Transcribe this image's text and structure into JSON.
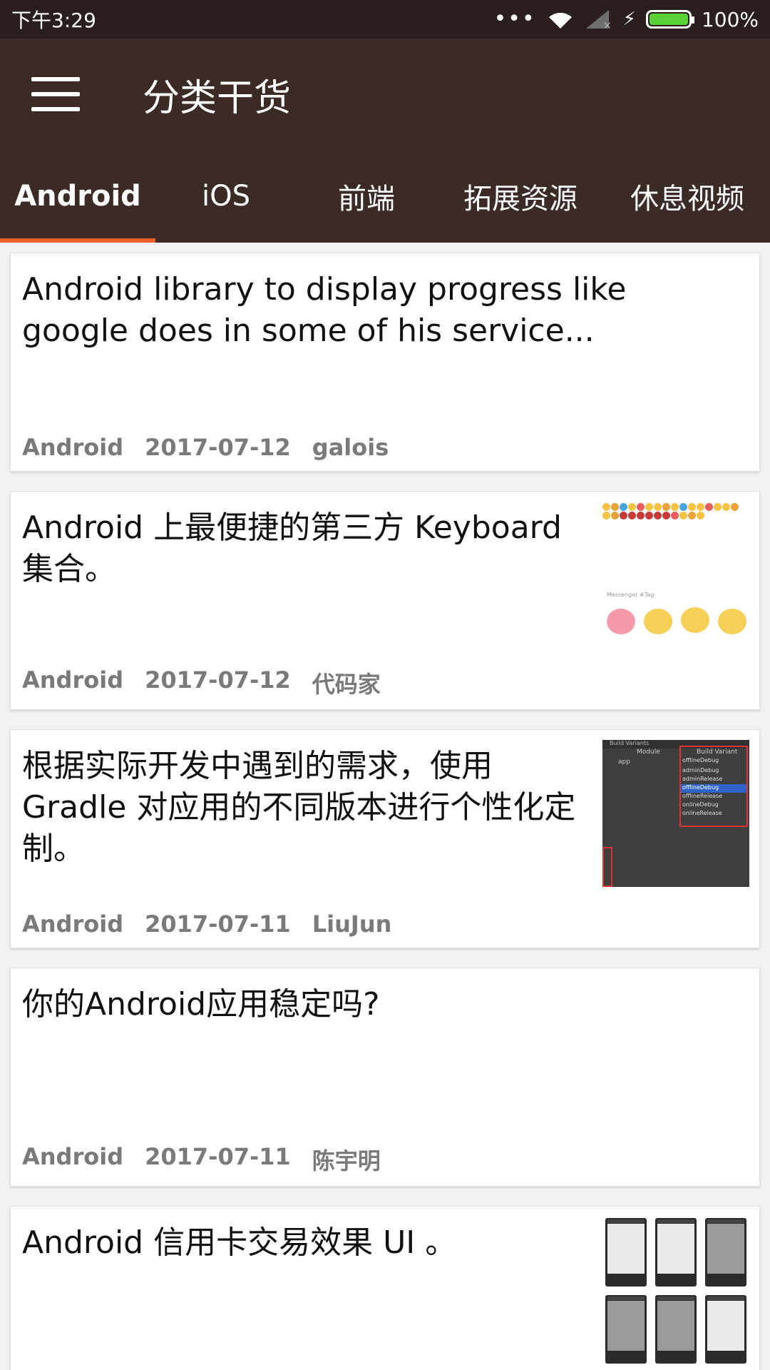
{
  "status_bar": {
    "time": "下午3:29",
    "dots": "•••",
    "battery_percent": "100%",
    "battery_level": 1.0,
    "battery_color": "#5ad236"
  },
  "toolbar": {
    "menu_icon": "hamburger-menu-icon",
    "title": "分类干货"
  },
  "tabs": [
    {
      "label": "Android",
      "active": true
    },
    {
      "label": "iOS",
      "active": false
    },
    {
      "label": "前端",
      "active": false
    },
    {
      "label": "拓展资源",
      "active": false
    },
    {
      "label": "休息视频",
      "active": false
    }
  ],
  "colors": {
    "toolbar_bg": "#3b2a25",
    "status_bg": "#2a1f1c",
    "tab_indicator": "#e85d2a"
  },
  "articles": [
    {
      "title": "Android library to display progress like google does in some of his service...",
      "category": "Android",
      "date": "2017-07-12",
      "author": "galois",
      "thumbnail": ""
    },
    {
      "title": "Android 上最便捷的第三方 Keyboard 集合。",
      "category": "Android",
      "date": "2017-07-12",
      "author": "代码家",
      "thumbnail": "emoji-keyboard-screenshot",
      "thumb_text": "Messenger #Tag"
    },
    {
      "title": "根据实际开发中遇到的需求，使用 Gradle 对应用的不同版本进行个性化定制。",
      "category": "Android",
      "date": "2017-07-11",
      "author": "LiuJun",
      "thumbnail": "build-variants-screenshot",
      "thumb_header": "Build Variants",
      "thumb_col_module": "Module",
      "thumb_col_variant": "Build Variant",
      "thumb_module": "app",
      "thumb_selected": "offlineDebug",
      "thumb_options": [
        "adminDebug",
        "adminRelease",
        "offlineDebug",
        "offlineRelease",
        "onlineDebug",
        "onlineRelease"
      ]
    },
    {
      "title": "你的Android应用稳定吗?",
      "category": "Android",
      "date": "2017-07-11",
      "author": "陈宇明",
      "thumbnail": ""
    },
    {
      "title": "Android 信用卡交易效果 UI 。",
      "category": "Android",
      "date": "",
      "author": "",
      "thumbnail": "phone-screens-screenshot"
    }
  ]
}
